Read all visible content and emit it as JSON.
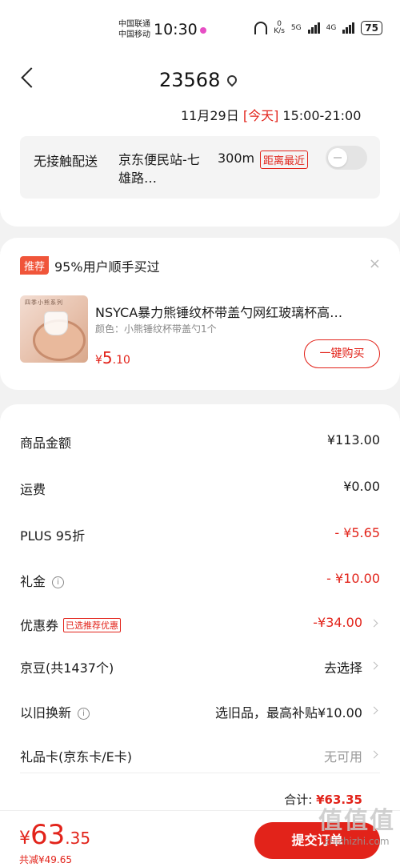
{
  "status_bar": {
    "carrier1": "中国联通",
    "carrier2": "中国移动",
    "time": "10:30",
    "net_speed": "0",
    "net_unit": "K/s",
    "net1": "5G",
    "net2": "4G",
    "battery": "75"
  },
  "header": {
    "address": "23568",
    "date": "11月29日",
    "today": "[今天]",
    "time_window": "15:00-21:00"
  },
  "delivery": {
    "label": "无接触配送",
    "station": "京东便民站-七雄路…",
    "distance": "300m",
    "badge": "距离最近"
  },
  "recommend": {
    "tag": "推荐",
    "title": "95%用户顺手买过",
    "close": "×",
    "thumb_text": "四季小熊系列",
    "product_name": "NSYCA暴力熊锤纹杯带盖勺网红玻璃杯高…",
    "spec": "颜色：小熊锤纹杯带盖勺1个",
    "price_symbol": "¥",
    "price_int": "5",
    "price_dec": ".10",
    "buy_label": "一键购买"
  },
  "summary": {
    "rows": [
      {
        "label": "商品金额",
        "value": "¥113.00"
      },
      {
        "label": "运费",
        "value": "¥0.00"
      },
      {
        "label": "PLUS 95折",
        "value": "- ¥5.65"
      },
      {
        "label": "礼金",
        "value": "- ¥10.00"
      },
      {
        "label": "优惠券",
        "badge": "已选推荐优惠",
        "value": "-¥34.00"
      },
      {
        "label": "京豆(共1437个)",
        "value": "去选择"
      },
      {
        "label": "以旧换新",
        "value": "选旧品，最高补贴¥10.00"
      },
      {
        "label": "礼品卡(京东卡/E卡)",
        "value": "无可用"
      }
    ],
    "total_label": "合计:",
    "total_value": "¥63.35"
  },
  "bottom": {
    "currency": "¥",
    "price_int": "63",
    "price_dec": ".35",
    "saved": "共减¥49.65",
    "submit": "提交订单"
  },
  "watermark": {
    "main": "值值值",
    "site": "zhizhizhi.com"
  },
  "colors": {
    "accent": "#e2231a",
    "recommend_tag": "#f0553a"
  }
}
